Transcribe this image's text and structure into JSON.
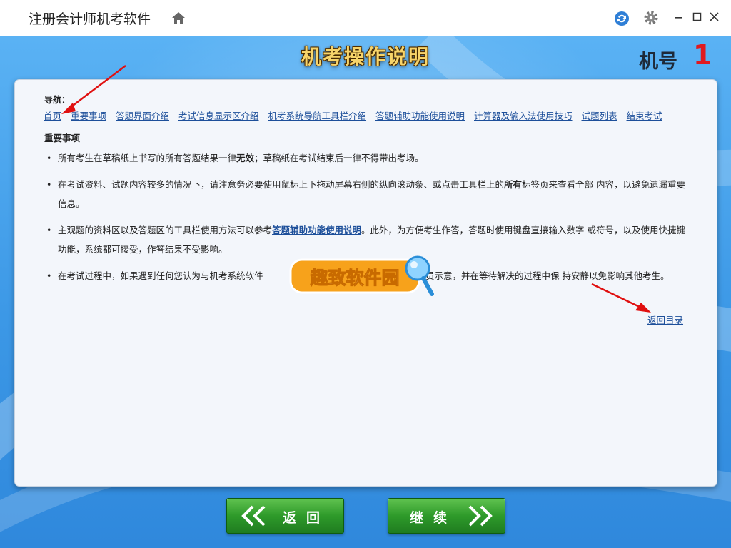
{
  "app": {
    "title": "注册会计师机考软件"
  },
  "banner": {
    "title": "机考操作说明",
    "machine_label": "机号",
    "machine_number": "1"
  },
  "nav": {
    "label": "导航：",
    "links": [
      "首页",
      "重要事项",
      "答题界面介绍",
      "考试信息显示区介绍",
      "机考系统导航工具栏介绍",
      "答题辅助功能使用说明",
      "计算器及输入法使用技巧",
      "试题列表",
      "结束考试"
    ]
  },
  "section": {
    "title": "重要事项"
  },
  "items": {
    "i1": {
      "a": "所有考生在草稿纸上书写的所有答题结果一律",
      "b": "无效",
      "c": "；草稿纸在考试结束后一律不得带出考场。"
    },
    "i2": {
      "a": "在考试资料、试题内容较多的情况下，请注意务必要使用鼠标上下拖动屏幕右侧的纵向滚动条、或点击工具栏上的",
      "b": "所有",
      "c": "标签页来查看全部 内容，以避免遗漏重要信息。"
    },
    "i3": {
      "a": "主观题的资料区以及答题区的工具栏使用方法可以参考",
      "link": "答题辅助功能使用说明",
      "c": "。此外，为方便考生作答，答题时使用键盘直接输入数字 或符号，以及使用快捷键功能，系统都可接受，作答结果不受影响。"
    },
    "i4": {
      "a": "在考试过程中，如果遇到任何您认为与机考系统软件",
      "c": "即举手向监考人员示意，并在等待解决的过程中保 持安静以免影响其他考生。"
    }
  },
  "back_to_toc": "返回目录",
  "watermark": "趣致软件园",
  "buttons": {
    "back": "返回",
    "next": "继续"
  },
  "colors": {
    "accent_link": "#1d4f9a",
    "machine_number": "#e0191f",
    "button_green": "#2e9a2a",
    "annotation_arrow": "#e01010"
  },
  "icons": [
    "home-icon",
    "refresh-icon",
    "gear-icon",
    "minimize-icon",
    "maximize-icon",
    "close-icon",
    "chevron-left-icon",
    "chevron-right-icon"
  ]
}
